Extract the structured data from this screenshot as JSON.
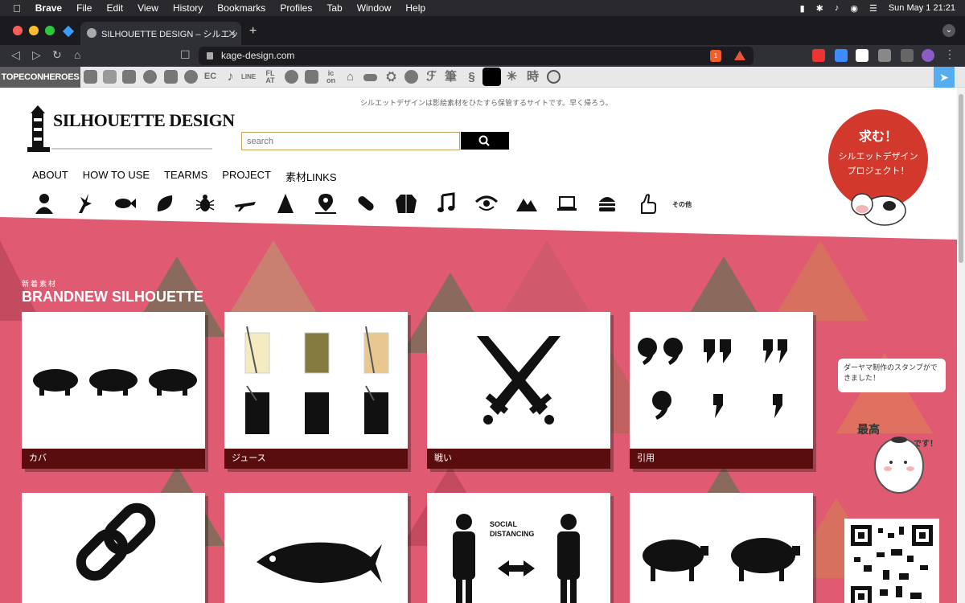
{
  "menubar": {
    "app": "Brave",
    "items": [
      "File",
      "Edit",
      "View",
      "History",
      "Bookmarks",
      "Profiles",
      "Tab",
      "Window",
      "Help"
    ],
    "datetime": "Sun May 1  21:21"
  },
  "browser": {
    "tab_title": "SILHOUETTE DESIGN – シルエッ",
    "new_tab": "+",
    "url": "kage-design.com",
    "shields_count": "1"
  },
  "iconstrip": {
    "brand": "TOPECONHEROES",
    "icons": [
      "ec-text",
      "line-text",
      "flat-text",
      "icon-text",
      "hitsuji-kanji",
      "fude-kanji",
      "toki-kanji"
    ],
    "labels": {
      "ec": "EC",
      "line": "LINE",
      "flat": "FL AT",
      "icon": "ic on",
      "fude": "筆",
      "toki": "時"
    }
  },
  "site": {
    "tagline": "シルエットデザインは影絵素材をひたすら保管するサイトです。早く帰ろう。",
    "logo_text": "SILHOUETTE DESIGN",
    "search_placeholder": "search",
    "nav": [
      "ABOUT",
      "HOW TO USE",
      "TEARMS",
      "PROJECT",
      "素材LINKS"
    ],
    "category_icons": [
      "person",
      "lizard",
      "fish",
      "leaf",
      "bug",
      "airplane",
      "tree",
      "map",
      "pill",
      "clothes",
      "music",
      "eye",
      "mountain",
      "laptop",
      "burger",
      "thumbs-up"
    ],
    "category_other": "その他",
    "badge": {
      "title": "求む！",
      "line1": "シルエットデザイン",
      "line2": "プロジェクト！"
    },
    "section_sub": "新着素材",
    "section_title": "BRANDNEW SILHOUETTE",
    "cards_row1": [
      "カバ",
      "ジュース",
      "戦い",
      "引用"
    ],
    "cards_row2_visible_text": [
      "SOCIAL",
      "DISTANCING"
    ],
    "speech": "ダーヤマ制作のスタンプができました！",
    "daryama_text": {
      "word1": "最高",
      "word2": "です！"
    }
  },
  "colors": {
    "hero_pink": "#e05a72",
    "card_caption": "#5a0d0d",
    "badge_red": "#d2382b",
    "twitter": "#55acee"
  }
}
